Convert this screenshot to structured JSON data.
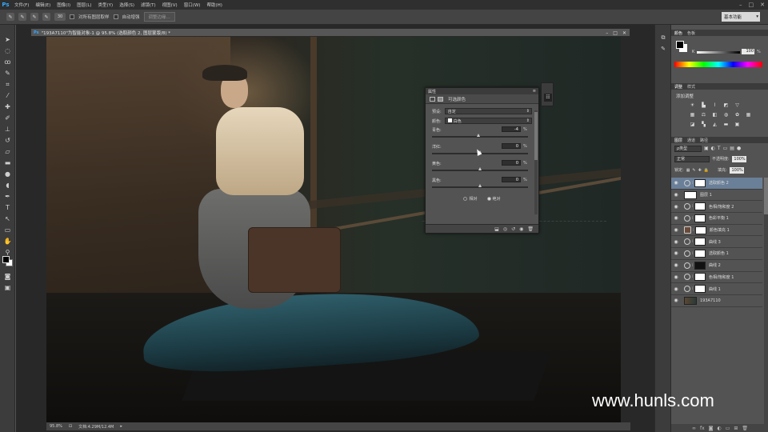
{
  "app": {
    "logo": "Ps"
  },
  "menu": [
    "文件(F)",
    "编辑(E)",
    "图像(I)",
    "图层(L)",
    "类型(Y)",
    "选择(S)",
    "滤镜(T)",
    "视图(V)",
    "窗口(W)",
    "帮助(H)"
  ],
  "window_controls": [
    "–",
    "□",
    "✕"
  ],
  "options_bar": {
    "brush_size": "30",
    "sample_all_layers": "对所有图层取样",
    "auto_enhance": "自动增强",
    "refine_edge": "调整边缘...",
    "workspace": "基本功能"
  },
  "document": {
    "tab_title": "\"193A7110\"为智能对象-1 @ 95.8% (选取颜色 2, 图层蒙版/8) *",
    "zoom": "95.8%",
    "doc_info": "文档:4.29M/12.4M",
    "doc_controls": [
      "–",
      "□",
      "✕"
    ]
  },
  "watermark": "www.hunls.com",
  "properties": {
    "tab": "属性",
    "title": "可选颜色",
    "preset_label": "预设:",
    "preset_value": "自定",
    "colors_label": "颜色:",
    "colors_value": "白色",
    "sliders": [
      {
        "label": "青色:",
        "value": "-4",
        "pct": "%",
        "pos": 0.48
      },
      {
        "label": "洋红:",
        "value": "0",
        "pct": "%",
        "pos": 0.5
      },
      {
        "label": "黄色:",
        "value": "0",
        "pct": "%",
        "pos": 0.5
      },
      {
        "label": "黑色:",
        "value": "0",
        "pct": "%",
        "pos": 0.5
      }
    ],
    "method_relative": "相对",
    "method_absolute": "绝对",
    "selected_method": "absolute"
  },
  "color_panel": {
    "tabs": [
      "颜色",
      "色板"
    ],
    "channel": "K",
    "value": "100",
    "pct": "%"
  },
  "adjustments_panel": {
    "tabs": [
      "调整",
      "样式"
    ],
    "label": "添加调整"
  },
  "layers_panel": {
    "tabs": [
      "图层",
      "通道",
      "路径"
    ],
    "filter": "ρ类型",
    "blend_mode": "正常",
    "opacity_label": "不透明度:",
    "opacity": "100%",
    "lock_label": "锁定:",
    "fill_label": "填充:",
    "fill": "100%",
    "layers": [
      {
        "name": "选取颜色 2",
        "selected": true,
        "mask": "white",
        "thumb": "adj"
      },
      {
        "name": "图层 1",
        "selected": false,
        "mask": "none",
        "thumb": "plain"
      },
      {
        "name": "色相/饱和度 2",
        "selected": false,
        "mask": "white",
        "thumb": "adj"
      },
      {
        "name": "色彩平衡 1",
        "selected": false,
        "mask": "white",
        "thumb": "adj"
      },
      {
        "name": "颜色填充 1",
        "selected": false,
        "mask": "white",
        "thumb": "fill"
      },
      {
        "name": "曲线 3",
        "selected": false,
        "mask": "white",
        "thumb": "adj"
      },
      {
        "name": "选取颜色 1",
        "selected": false,
        "mask": "white",
        "thumb": "adj"
      },
      {
        "name": "曲线 2",
        "selected": false,
        "mask": "dark",
        "thumb": "adj"
      },
      {
        "name": "色相/饱和度 1",
        "selected": false,
        "mask": "white",
        "thumb": "adj"
      },
      {
        "name": "曲线 1",
        "selected": false,
        "mask": "white",
        "thumb": "adj"
      },
      {
        "name": "193A7110",
        "selected": false,
        "mask": "none",
        "thumb": "photo"
      }
    ]
  }
}
